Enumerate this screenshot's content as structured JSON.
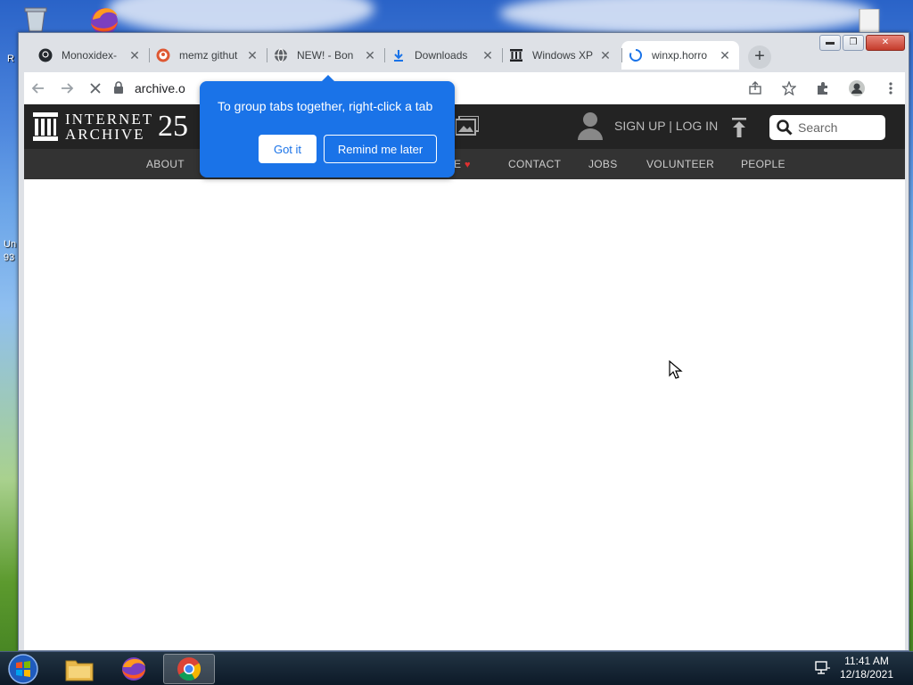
{
  "desktop": {
    "left_edge_text_1": "R",
    "left_edge_text_2": "Un",
    "left_edge_text_3": "93"
  },
  "browser": {
    "tabs": [
      {
        "title": "Monoxidex-",
        "icon": "github-icon"
      },
      {
        "title": "memz githut",
        "icon": "duckduckgo-icon"
      },
      {
        "title": "NEW! - Bon",
        "icon": "globe-icon"
      },
      {
        "title": "Downloads",
        "icon": "download-icon"
      },
      {
        "title": "Windows XP",
        "icon": "archive-icon"
      },
      {
        "title": "winxp.horro",
        "icon": "loading-spinner-icon",
        "active": true
      }
    ],
    "new_tab_label": "+",
    "address": "archive.o",
    "window_buttons": {
      "minimize": "▬",
      "maximize": "❐",
      "close": "✕"
    }
  },
  "promo_bubble": {
    "message": "To group tabs together, right-click a tab",
    "got_it": "Got it",
    "remind_later": "Remind me later"
  },
  "site": {
    "logo_line1": "INTERNET",
    "logo_line2": "ARCHIVE",
    "logo_25": "25",
    "account_link": "SIGN UP | LOG IN",
    "search_placeholder": "Search",
    "nav": {
      "about": "ABOUT",
      "donate": "E",
      "contact": "CONTACT",
      "jobs": "JOBS",
      "volunteer": "VOLUNTEER",
      "people": "PEOPLE"
    },
    "accent": "#ff0000"
  },
  "taskbar": {
    "time": "11:41 AM",
    "date": "12/18/2021"
  }
}
